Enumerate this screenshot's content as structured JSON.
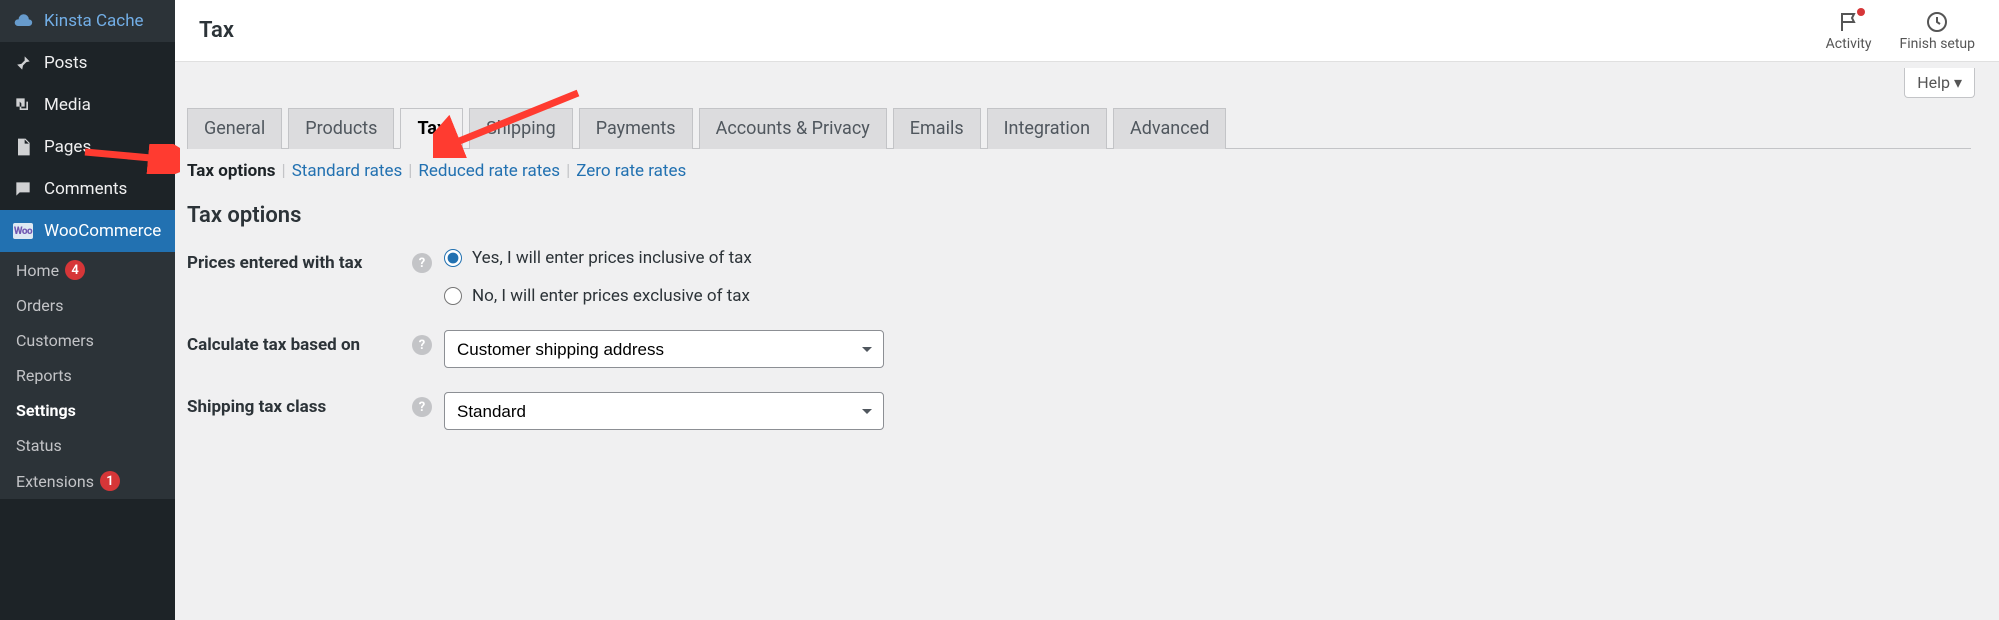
{
  "sidebar": {
    "items": [
      {
        "label": "Kinsta Cache",
        "icon": "cloud"
      },
      {
        "label": "Posts",
        "icon": "pin"
      },
      {
        "label": "Media",
        "icon": "media"
      },
      {
        "label": "Pages",
        "icon": "page"
      },
      {
        "label": "Comments",
        "icon": "comment"
      },
      {
        "label": "WooCommerce",
        "icon": "woo",
        "current": true
      }
    ],
    "submenu": [
      {
        "label": "Home",
        "badge": "4"
      },
      {
        "label": "Orders"
      },
      {
        "label": "Customers"
      },
      {
        "label": "Reports"
      },
      {
        "label": "Settings",
        "current": true
      },
      {
        "label": "Status"
      },
      {
        "label": "Extensions",
        "badge": "1"
      }
    ]
  },
  "topbar": {
    "title": "Tax",
    "activity": "Activity",
    "finish": "Finish setup"
  },
  "help_tab": "Help",
  "tabs": [
    {
      "label": "General"
    },
    {
      "label": "Products"
    },
    {
      "label": "Tax",
      "active": true
    },
    {
      "label": "Shipping"
    },
    {
      "label": "Payments"
    },
    {
      "label": "Accounts & Privacy"
    },
    {
      "label": "Emails"
    },
    {
      "label": "Integration"
    },
    {
      "label": "Advanced"
    }
  ],
  "subtabs": [
    {
      "label": "Tax options",
      "current": true
    },
    {
      "label": "Standard rates"
    },
    {
      "label": "Reduced rate rates"
    },
    {
      "label": "Zero rate rates"
    }
  ],
  "section": {
    "title": "Tax options",
    "prices_label": "Prices entered with tax",
    "prices_opts": [
      {
        "label": "Yes, I will enter prices inclusive of tax",
        "checked": true
      },
      {
        "label": "No, I will enter prices exclusive of tax",
        "checked": false
      }
    ],
    "calc_label": "Calculate tax based on",
    "calc_value": "Customer shipping address",
    "ship_label": "Shipping tax class",
    "ship_value": "Standard"
  }
}
